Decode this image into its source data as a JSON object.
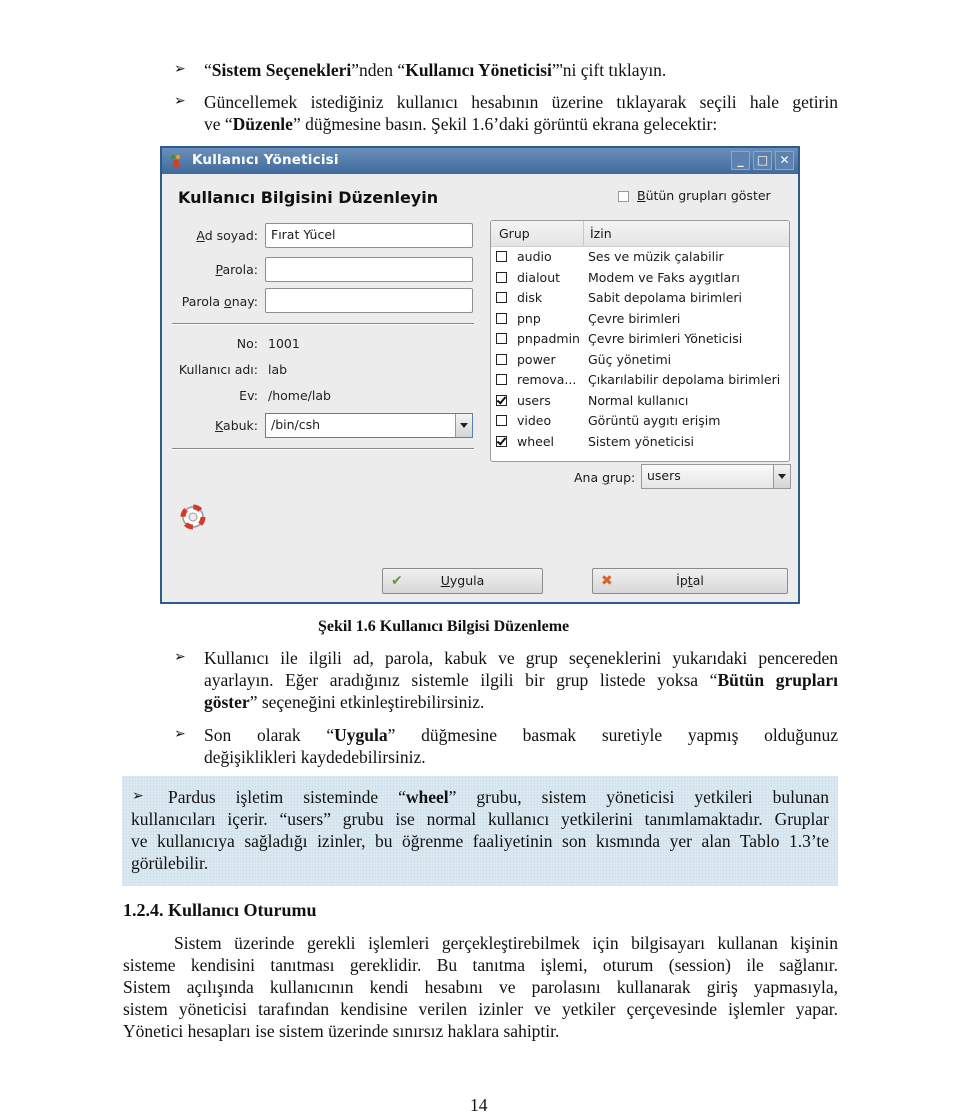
{
  "intro_bullets": [
    {
      "q1": "“",
      "b1": "Sistem Seçenekleri",
      "t1": "”nden “",
      "b2": "Kullanıcı Yöneticisi",
      "t2": "”'ni çift tıklayın."
    },
    {
      "line1": "Güncellemek istediğiniz kullanıcı hesabının üzerine tıklayarak seçili hale getirin",
      "l2a": "ve “",
      "l2b": "Düzenle",
      "l2c": "” düğmesine basın. Şekil 1.6’daki görüntü ekrana gelecektir:"
    }
  ],
  "window": {
    "title": "Kullanıcı Yöneticisi",
    "controls": {
      "minimize": "_",
      "maximize": "□",
      "close": "✕"
    },
    "heading": "Kullanıcı Bilgisini Düzenleyin",
    "fields": {
      "name_label_u": "A",
      "name_label_rest": "d soyad:",
      "name_value": "Fırat Yücel",
      "password_label_u": "P",
      "password_label_rest": "arola:",
      "password_value": "",
      "confirm_label_a": "Parola ",
      "confirm_label_u": "o",
      "confirm_label_rest": "nay:",
      "confirm_value": "",
      "no_label": "No:",
      "no_value": "1001",
      "username_label": "Kullanıcı adı:",
      "username_value": "lab",
      "home_label": "Ev:",
      "home_value": "/home/lab",
      "shell_label_u": "K",
      "shell_label_rest": "abuk:",
      "shell_value": "/bin/csh"
    },
    "show_all_groups": {
      "label_u": "B",
      "label_rest": "ütün grupları göster",
      "checked": false
    },
    "groups_table": {
      "headers": [
        "Grup",
        "İzin"
      ],
      "rows": [
        {
          "group": "audio",
          "permission": "Ses ve müzik çalabilir",
          "checked": false
        },
        {
          "group": "dialout",
          "permission": "Modem ve Faks aygıtları",
          "checked": false
        },
        {
          "group": "disk",
          "permission": "Sabit depolama birimleri",
          "checked": false
        },
        {
          "group": "pnp",
          "permission": "Çevre birimleri",
          "checked": false
        },
        {
          "group": "pnpadmin",
          "permission": "Çevre birimleri Yöneticisi",
          "checked": false
        },
        {
          "group": "power",
          "permission": "Güç yönetimi",
          "checked": false
        },
        {
          "group": "remova...",
          "permission": "Çıkarılabilir depolama birimleri",
          "checked": false
        },
        {
          "group": "users",
          "permission": "Normal kullanıcı",
          "checked": true
        },
        {
          "group": "video",
          "permission": "Görüntü aygıtı erişim",
          "checked": false
        },
        {
          "group": "wheel",
          "permission": "Sistem yöneticisi",
          "checked": true
        }
      ]
    },
    "main_group": {
      "label_a": "Ana ",
      "label_u": "g",
      "label_rest": "rup:",
      "value": "users"
    },
    "buttons": {
      "apply_u": "U",
      "apply_rest": "ygula",
      "apply_icon": "✔",
      "cancel_a": "İp",
      "cancel_u": "t",
      "cancel_rest": "al",
      "cancel_icon": "✖"
    }
  },
  "caption": "Şekil 1.6 Kullanıcı Bilgisi Düzenleme",
  "bullets_after": [
    {
      "l1": "Kullanıcı ile ilgili ad, parola, kabuk ve grup seçeneklerini yukarıdaki pencereden",
      "l2a": "ayarlayın. Eğer aradığınız sistemle ilgili bir grup listede yoksa “",
      "l2b": "Bütün grupları",
      "l3b": "göster",
      "l3c": "” seçeneğini etkinleştirebilirsiniz."
    },
    {
      "l1a": "Son olarak “",
      "l1b": "Uygula",
      "l1c": "” düğmesine basmak suretiyle yapmış olduğunuz",
      "l2": "değişiklikleri kaydedebilirsiniz."
    }
  ],
  "note": {
    "l1a": "Pardus işletim sisteminde “",
    "l1b": "wheel",
    "l1c": "” grubu, sistem yöneticisi yetkileri bulunan",
    "l2": "kullanıcıları içerir. “users” grubu ise normal kullanıcı yetkilerini tanımlamaktadır. Gruplar",
    "l3": "ve kullanıcıya sağladığı izinler, bu öğrenme faaliyetinin son kısmında yer alan Tablo 1.3’te",
    "l4": "görülebilir."
  },
  "section": {
    "heading": "1.2.4. Kullanıcı Oturumu",
    "lines": [
      "Sistem üzerinde gerekli işlemleri gerçekleştirebilmek için bilgisayarı kullanan kişinin",
      "sisteme kendisini tanıtması gereklidir. Bu tanıtma işlemi, oturum (session) ile sağlanır.",
      "Sistem açılışında kullanıcının kendi hesabını ve parolasını kullanarak giriş yapmasıyla,",
      "sistem yöneticisi tarafından kendisine verilen izinler ve yetkiler çerçevesinde işlemler yapar.",
      "Yönetici hesapları ise sistem üzerinde sınırsız haklara sahiptir."
    ]
  },
  "page_number": "14",
  "bullet_glyph": "➢"
}
